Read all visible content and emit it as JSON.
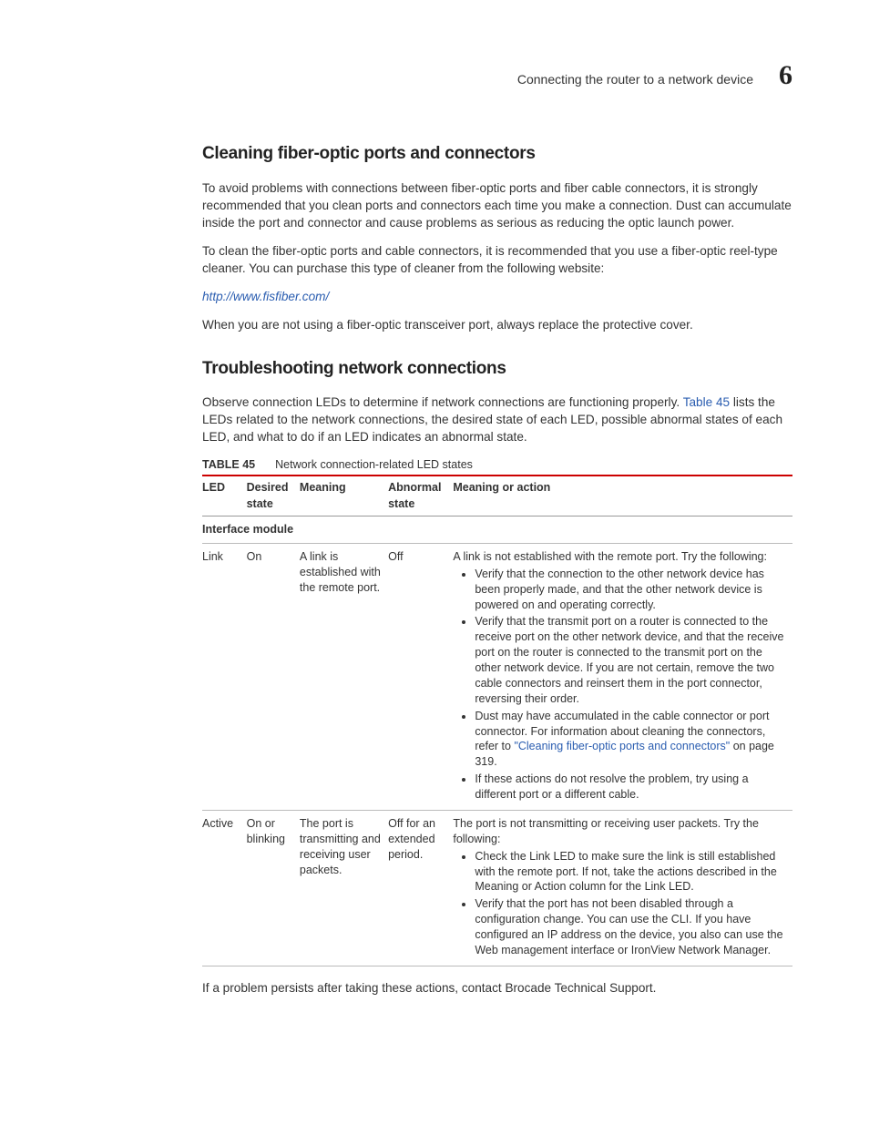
{
  "header": {
    "section_title": "Connecting the router to a network device",
    "chapter_number": "6"
  },
  "s1": {
    "heading": "Cleaning fiber-optic ports and connectors",
    "p1": "To avoid problems with connections between fiber-optic ports and fiber cable connectors, it is strongly recommended that you clean ports and connectors each time you make a connection. Dust can accumulate inside the port and connector and cause problems as serious as reducing the optic launch power.",
    "p2": "To clean the fiber-optic ports and cable connectors, it is recommended that you use a fiber-optic reel-type cleaner. You can purchase this type of cleaner from the following website:",
    "link": "http://www.fisfiber.com/",
    "p3": "When you are not using a fiber-optic transceiver port, always replace the protective cover."
  },
  "s2": {
    "heading": "Troubleshooting network connections",
    "p1_a": "Observe connection LEDs to determine if network connections are functioning properly. ",
    "p1_link": "Table 45",
    "p1_b": " lists the LEDs related to the network connections, the desired state of each LED, possible abnormal states of each LED, and what to do if an LED indicates an abnormal state."
  },
  "table": {
    "label": "TABLE 45",
    "title": "Network connection-related LED states",
    "head": {
      "c1": "LED",
      "c2": "Desired state",
      "c3": "Meaning",
      "c4": "Abnormal state",
      "c5": "Meaning or action"
    },
    "sub1": "Interface module",
    "r1": {
      "c1": "Link",
      "c2": "On",
      "c3": "A link is established with the remote port.",
      "c4": "Off",
      "c5_intro": "A link is not established with the remote port. Try the following:",
      "b1": "Verify that the connection to the other network device has been properly made, and that the other network device is powered on and operating correctly.",
      "b2": "Verify that the transmit port on a router is connected to the receive port on the other network device, and that the receive port on the router is connected to the transmit port on the other network device. If you are not certain, remove the two cable connectors and reinsert them in the port connector, reversing their order.",
      "b3_a": "Dust may have accumulated in the cable connector or port connector. For information about cleaning the connectors, refer to ",
      "b3_link": "\"Cleaning fiber-optic ports and connectors\"",
      "b3_b": " on page 319.",
      "b4": "If these actions do not resolve the problem, try using a different port or a different cable."
    },
    "r2": {
      "c1": "Active",
      "c2": "On or blinking",
      "c3": "The port is transmitting and receiving user packets.",
      "c4": "Off for an extended period.",
      "c5_intro": "The port is not transmitting or receiving user packets. Try the following:",
      "b1": "Check the Link LED to make sure the link is still established with the remote port. If not, take the actions described in the Meaning or Action column for the Link LED.",
      "b2": "Verify that the port has not been disabled through a configuration change. You can use the CLI. If you have configured an IP address on the device, you also can use the Web management interface or IronView Network Manager."
    }
  },
  "after_table": "If a problem persists after taking these actions, contact Brocade Technical Support."
}
